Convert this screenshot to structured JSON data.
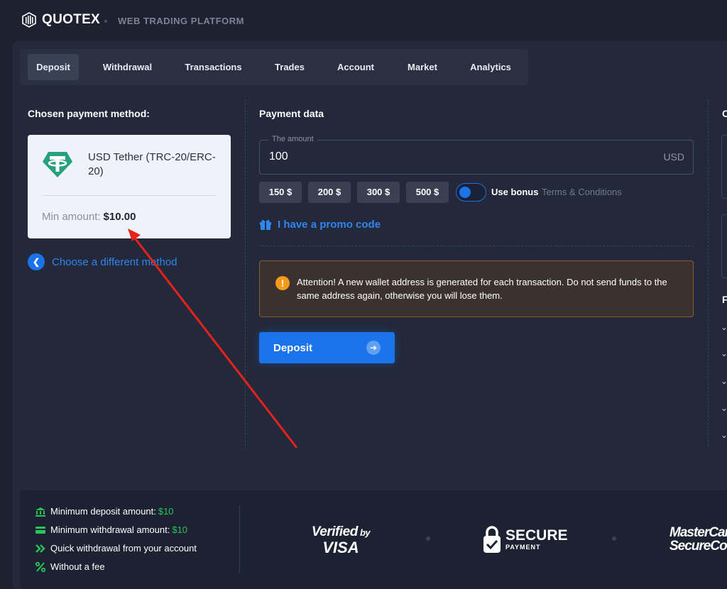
{
  "header": {
    "brand": "QUOTEX",
    "platform_label": "WEB TRADING PLATFORM"
  },
  "tabs": [
    {
      "label": "Deposit",
      "active": true
    },
    {
      "label": "Withdrawal",
      "active": false
    },
    {
      "label": "Transactions",
      "active": false
    },
    {
      "label": "Trades",
      "active": false
    },
    {
      "label": "Account",
      "active": false
    },
    {
      "label": "Market",
      "active": false
    },
    {
      "label": "Analytics",
      "active": false
    }
  ],
  "payment_method": {
    "title": "Chosen payment method:",
    "name": "USD Tether (TRC-20/ERC-20)",
    "min_label": "Min amount:",
    "min_value": "$10.00",
    "icon": "tether-icon",
    "change_label": "Choose a different method"
  },
  "payment_data": {
    "title": "Payment data",
    "amount_legend": "The amount",
    "amount_value": "100",
    "currency": "USD",
    "quick_amounts": [
      "150 $",
      "200 $",
      "300 $",
      "500 $"
    ],
    "use_bonus_label": "Use bonus",
    "use_bonus_on": true,
    "terms_label": "Terms & Conditions",
    "promo_label": "I have a promo code",
    "alert_text": "Attention! A new wallet address is generated for each transaction. Do not send funds to the same address again, otherwise you will lose them.",
    "deposit_label": "Deposit"
  },
  "right_column": {
    "title_partial": "C",
    "faq_partial": "F"
  },
  "footer": {
    "features": [
      {
        "icon": "bank-icon",
        "text": "Minimum deposit amount:",
        "value": "$10"
      },
      {
        "icon": "card-icon",
        "text": "Minimum withdrawal amount:",
        "value": "$10"
      },
      {
        "icon": "double-chevron-icon",
        "text": "Quick withdrawal from your account",
        "value": ""
      },
      {
        "icon": "percent-icon",
        "text": "Without a fee",
        "value": ""
      }
    ],
    "badges": {
      "visa_line1": "Verified",
      "visa_by": "by",
      "visa_line2": "VISA",
      "secure_line1": "SECURE",
      "secure_line2": "PAYMENT",
      "mastercard_line1": "MasterCar",
      "mastercard_line2": "SecureCod"
    }
  },
  "colors": {
    "accent": "#1a73e8",
    "link": "#2f86ee",
    "success": "#2bc45b",
    "warning": "#f59a1b",
    "arrow_annotation": "#e8221b"
  }
}
